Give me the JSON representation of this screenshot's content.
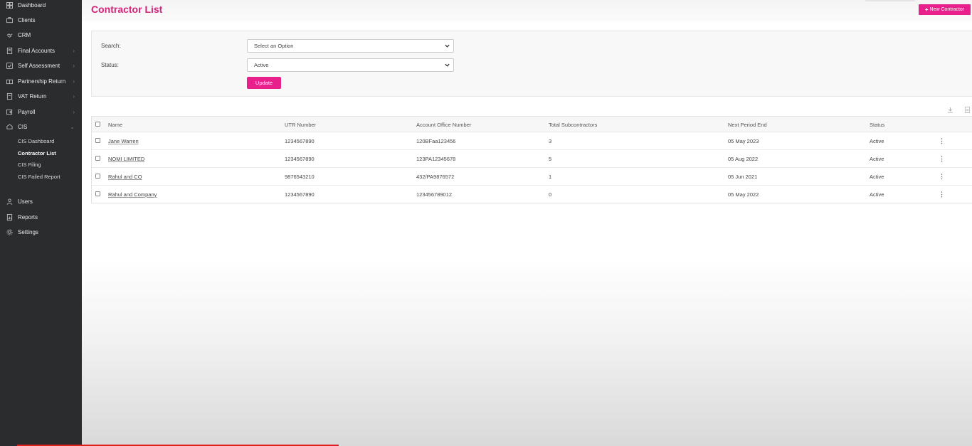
{
  "sidebar": {
    "items": [
      {
        "label": "Dashboard",
        "icon": "dashboard-icon",
        "chevron": false
      },
      {
        "label": "Clients",
        "icon": "clients-icon",
        "chevron": false
      },
      {
        "label": "CRM",
        "icon": "crm-icon",
        "chevron": false
      },
      {
        "label": "Final Accounts",
        "icon": "final-accounts-icon",
        "chevron": true
      },
      {
        "label": "Self Assessment",
        "icon": "self-assessment-icon",
        "chevron": true
      },
      {
        "label": "Partnership Return",
        "icon": "partnership-icon",
        "chevron": true
      },
      {
        "label": "VAT Return",
        "icon": "vat-icon",
        "chevron": true
      },
      {
        "label": "Payroll",
        "icon": "payroll-icon",
        "chevron": true
      },
      {
        "label": "CIS",
        "icon": "cis-icon",
        "chevron": true
      }
    ],
    "cis_sub": [
      {
        "label": "CIS Dashboard",
        "active": false
      },
      {
        "label": "Contractor List",
        "active": true
      },
      {
        "label": "CIS Filing",
        "active": false
      },
      {
        "label": "CIS Failed Report",
        "active": false
      }
    ],
    "bottom": [
      {
        "label": "Users",
        "icon": "users-icon"
      },
      {
        "label": "Reports",
        "icon": "reports-icon"
      },
      {
        "label": "Settings",
        "icon": "settings-icon"
      }
    ]
  },
  "header": {
    "title": "Contractor List",
    "new_button": "New Contractor"
  },
  "filter": {
    "search_label": "Search:",
    "search_value": "Select an Option",
    "status_label": "Status:",
    "status_value": "Active",
    "update_label": "Update"
  },
  "table": {
    "columns": [
      "Name",
      "UTR Number",
      "Account Office Number",
      "Total Subcontractors",
      "Next Period End",
      "Status"
    ],
    "rows": [
      [
        "Jane Warren",
        "1234567890",
        "120BFaa123456",
        "3",
        "05 May 2023",
        "Active"
      ],
      [
        "NOMI LIMITED",
        "1234567890",
        "123PA12345678",
        "5",
        "05 Aug 2022",
        "Active"
      ],
      [
        "Rahul and CO",
        "9876543210",
        "432/PA9876572",
        "1",
        "05 Jun 2021",
        "Active"
      ],
      [
        "Rahul and Company",
        "1234567890",
        "123456789012",
        "0",
        "05 May 2022",
        "Active"
      ]
    ],
    "row_menu": "⋮"
  },
  "colors": {
    "sidebar_bg": "#2b2c2e",
    "accent": "#e8208b",
    "title": "#d4227a"
  }
}
